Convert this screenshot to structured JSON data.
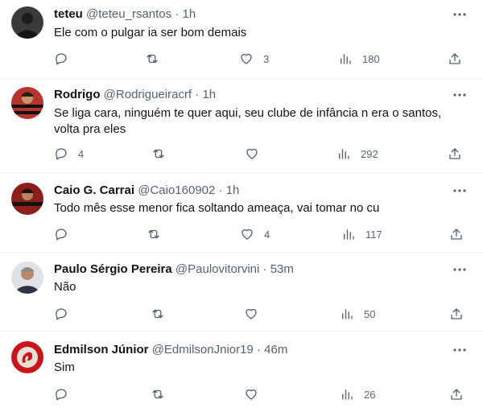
{
  "tweets": [
    {
      "name": "teteu",
      "handle": "@teteu_rsantos",
      "time": "1h",
      "text": [
        "Ele com o pulgar ia ser bom demais"
      ],
      "replies": "",
      "likes": "3",
      "views": "180",
      "avatar_icon": "dark-person-photo"
    },
    {
      "name": "Rodrigo",
      "handle": "@Rodrigueiracrf",
      "time": "1h",
      "text": [
        "Se liga cara, ninguém te quer aqui, seu clube de infância n era o santos,",
        "volta pra eles"
      ],
      "replies": "4",
      "likes": "",
      "views": "292",
      "avatar_icon": "red-black-jersey-photo"
    },
    {
      "name": "Caio G. Carrai",
      "handle": "@Caio160902",
      "time": "1h",
      "text": [
        "Todo mês esse menor fica soltando ameaça, vai tomar no cu"
      ],
      "replies": "",
      "likes": "4",
      "views": "117",
      "avatar_icon": "red-black-jersey-photo"
    },
    {
      "name": "Paulo Sérgio Pereira",
      "handle": "@Paulovitorvini",
      "time": "53m",
      "text": [
        "Não"
      ],
      "replies": "",
      "likes": "",
      "views": "50",
      "avatar_icon": "man-portrait-photo"
    },
    {
      "name": "Edmilson Júnior",
      "handle": "@EdmilsonJnior19",
      "time": "46m",
      "text": [
        "Sim"
      ],
      "replies": "",
      "likes": "",
      "views": "26",
      "avatar_icon": "red-dragon-logo"
    }
  ],
  "separator": "·",
  "colors": {
    "text": "#0f1419",
    "muted": "#536471",
    "border": "#eff3f4"
  }
}
